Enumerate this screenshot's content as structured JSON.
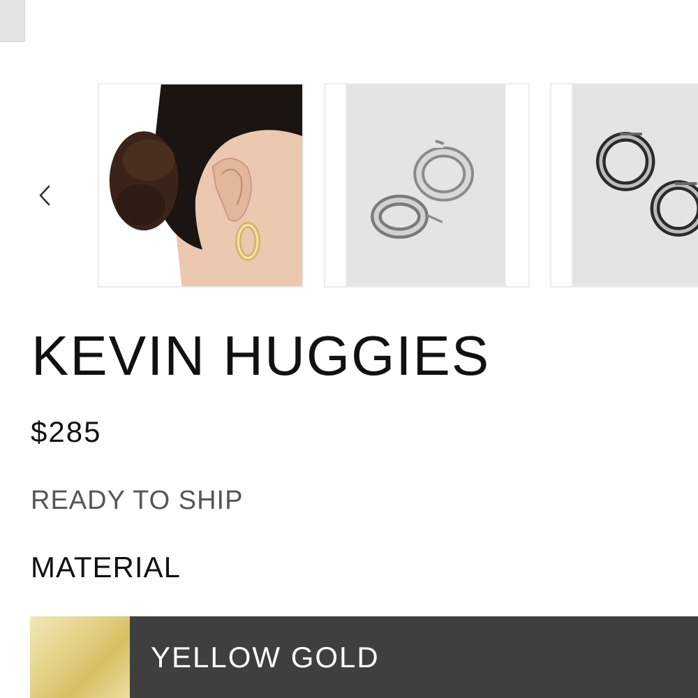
{
  "product": {
    "title": "KEVIN HUGGIES",
    "price": "$285",
    "availability": "READY TO SHIP"
  },
  "gallery": {
    "prev_icon": "chevron-left-icon",
    "thumbnails": [
      {
        "subject": "model-ear-with-gold-hoop"
      },
      {
        "subject": "silver-hoops-pair-1"
      },
      {
        "subject": "silver-hoops-pair-2"
      }
    ]
  },
  "material": {
    "label": "MATERIAL",
    "selected": "YELLOW GOLD"
  },
  "colors": {
    "option_bar": "#3f3f3f",
    "secondary_text": "#555555",
    "thumb_border": "#ececec"
  }
}
